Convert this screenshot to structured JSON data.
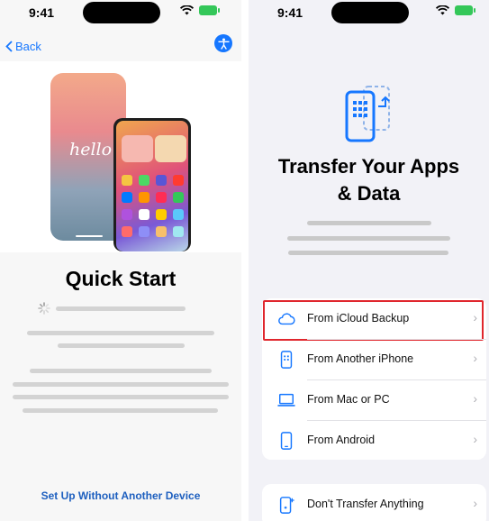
{
  "left_screen": {
    "status": {
      "time": "9:41"
    },
    "nav": {
      "back_label": "Back"
    },
    "hero": {
      "hello_text": "hello"
    },
    "title": "Quick Start",
    "bottom_link": "Set Up Without Another Device"
  },
  "right_screen": {
    "status": {
      "time": "9:41"
    },
    "title_line1": "Transfer Your Apps",
    "title_line2": "& Data",
    "options": [
      {
        "label": "From iCloud Backup",
        "icon": "cloud-icon",
        "highlighted": true
      },
      {
        "label": "From Another iPhone",
        "icon": "iphone-icon",
        "highlighted": false
      },
      {
        "label": "From Mac or PC",
        "icon": "laptop-icon",
        "highlighted": false
      },
      {
        "label": "From Android",
        "icon": "android-phone-icon",
        "highlighted": false
      }
    ],
    "secondary_option": {
      "label": "Don't Transfer Anything",
      "icon": "phone-sparkle-icon"
    }
  },
  "colors": {
    "accent": "#1677ff",
    "highlight": "#e0262d",
    "battery": "#34c759"
  }
}
